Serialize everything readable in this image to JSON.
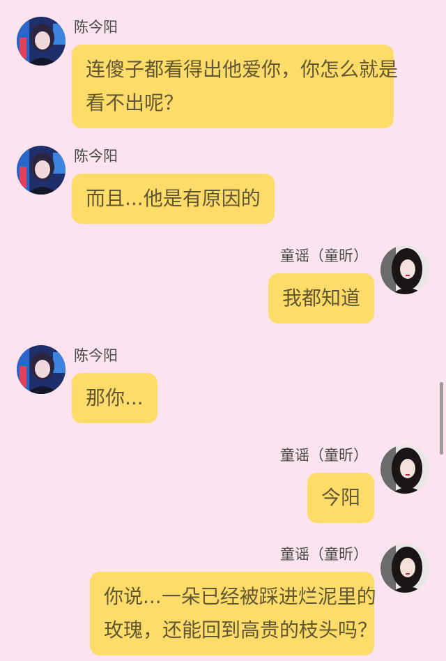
{
  "messages": [
    {
      "side": "left",
      "sender": "陈今阳",
      "avatar_icon": "girl-neon-avatar-icon",
      "lines": [
        "连傻子都看得出他爱你，你怎么就是",
        "看不出呢？"
      ]
    },
    {
      "side": "left",
      "sender": "陈今阳",
      "avatar_icon": "girl-neon-avatar-icon",
      "lines": [
        "而且...他是有原因的"
      ]
    },
    {
      "side": "right",
      "sender": "童谣（童昕）",
      "avatar_icon": "girl-dark-hair-avatar-icon",
      "lines": [
        "我都知道"
      ]
    },
    {
      "side": "left",
      "sender": "陈今阳",
      "avatar_icon": "girl-neon-avatar-icon",
      "lines": [
        "那你..."
      ]
    },
    {
      "side": "right",
      "sender": "童谣（童昕）",
      "avatar_icon": "girl-dark-hair-avatar-icon",
      "lines": [
        "今阳"
      ]
    },
    {
      "side": "right",
      "sender": "童谣（童昕）",
      "avatar_icon": "girl-dark-hair-avatar-icon",
      "lines": [
        "你说...一朵已经被踩进烂泥里的",
        "玫瑰，还能回到高贵的枝头吗？"
      ]
    }
  ],
  "colors": {
    "background": "#fbe4ef",
    "bubble": "#fedc6a",
    "bubble_text": "#625733",
    "name_text": "#4a4a4a"
  }
}
